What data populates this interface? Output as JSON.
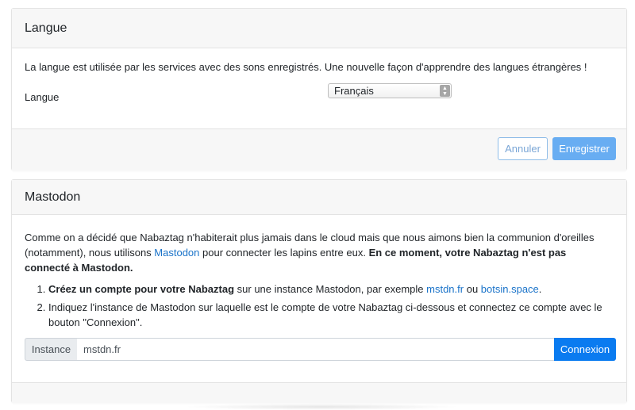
{
  "langue": {
    "title": "Langue",
    "intro": "La langue est utilisée par les services avec des sons enregistrés. Une nouvelle façon d'apprendre des langues étrangères !",
    "field_label": "Langue",
    "selected": "Français",
    "cancel_label": "Annuler",
    "save_label": "Enregistrer"
  },
  "mastodon": {
    "title": "Mastodon",
    "intro_part1": "Comme on a décidé que Nabaztag n'habiterait plus jamais dans le cloud mais que nous aimons bien la communion d'oreilles (notamment), nous utilisons ",
    "intro_link": "Mastodon",
    "intro_part2": " pour connecter les lapins entre eux. ",
    "intro_bold": "En ce moment, votre Nabaztag n'est pas connecté à Mastodon",
    "intro_end": ".",
    "step1_bold": "Créez un compte pour votre Nabaztag",
    "step1_text": " sur une instance Mastodon, par exemple ",
    "step1_link1": "mstdn.fr",
    "step1_or": " ou ",
    "step1_link2": "botsin.space",
    "step1_end": ".",
    "step2_text": "Indiquez l'instance de Mastodon sur laquelle est le compte de votre Nabaztag ci-dessous et connectez ce compte avec le bouton \"Connexion\".",
    "instance_label": "Instance",
    "instance_value": "mstdn.fr",
    "connect_label": "Connexion"
  },
  "colors": {
    "primary": "#0a7bf0",
    "primary_light": "#68adf2",
    "link": "#1a73c9",
    "header_bg": "#f7f7f7"
  }
}
